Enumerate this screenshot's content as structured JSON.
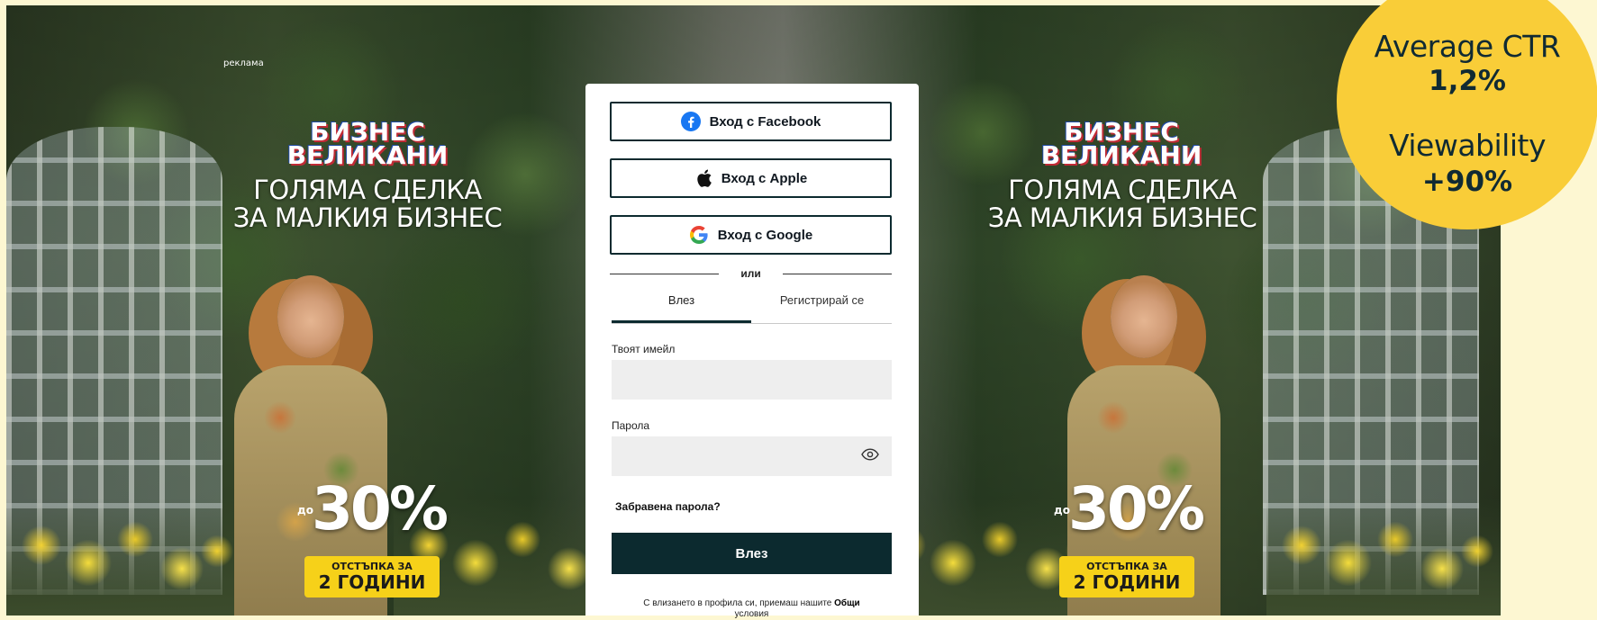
{
  "ad": {
    "label": "реклама",
    "brand_line1": "БИЗНЕС",
    "brand_line2": "ВЕЛИКАНИ",
    "slogan_line1": "ГОЛЯМА СДЕЛКА",
    "slogan_line2": "ЗА МАЛКИЯ БИЗНЕС",
    "discount_prefix": "до",
    "discount_value": "30%",
    "badge_top": "ОТСТЪПКА ЗА",
    "badge_bottom": "2 ГОДИНИ"
  },
  "login": {
    "facebook_label": "Вход с Facebook",
    "apple_label": "Вход с Apple",
    "google_label": "Вход с Google",
    "divider_text": "или",
    "tabs": [
      {
        "label": "Влез",
        "active": true
      },
      {
        "label": "Регистрирай се",
        "active": false
      }
    ],
    "email_label": "Твоят имейл",
    "email_value": "",
    "password_label": "Парола",
    "password_value": "",
    "forgot_label": "Забравена парола?",
    "submit_label": "Влез",
    "terms_text": "С влизането в профила си, приемаш нашите",
    "terms_link": "Общи",
    "terms_link2": "условия"
  },
  "stats": {
    "ctr_label": "Average CTR",
    "ctr_value": "1,2%",
    "viewability_label": "Viewability",
    "viewability_value": "+90%"
  },
  "colors": {
    "page_background": "#fdf7d2",
    "stats_circle": "#f9cd38",
    "button_dark": "#0c2a2f",
    "promo_yellow": "#f6d119"
  }
}
